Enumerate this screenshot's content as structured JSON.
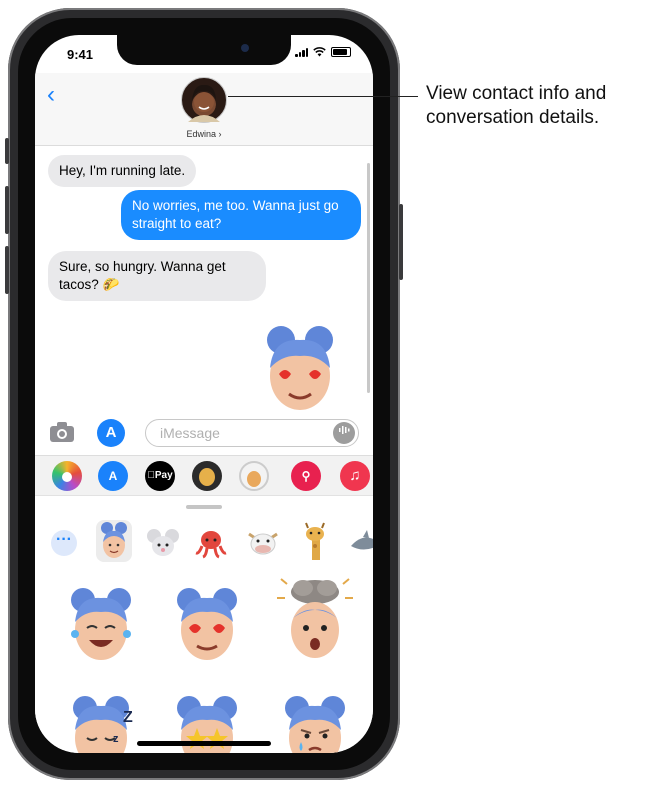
{
  "status_bar": {
    "time": "9:41"
  },
  "header": {
    "back_label": "‹",
    "contact_name": "Edwina ›"
  },
  "messages": [
    {
      "dir": "in",
      "text": "Hey, I'm running late."
    },
    {
      "dir": "out",
      "text": "No worries, me too. Wanna just go straight to eat?"
    },
    {
      "dir": "in",
      "text": "Sure, so hungry. Wanna get tacos? 🌮"
    }
  ],
  "compose": {
    "placeholder": "iMessage"
  },
  "app_drawer": {
    "apps": [
      "photos-icon",
      "app-store-icon",
      "apple-pay-icon",
      "memoji-icon",
      "memoji-stickers-icon",
      "search-images-icon",
      "music-icon"
    ],
    "apple_pay_label": "Pay"
  },
  "sticker_categories": [
    "more-icon",
    "memoji",
    "mouse",
    "octopus",
    "cow",
    "giraffe",
    "shark"
  ],
  "stickers": [
    "memoji-laughing-tears",
    "memoji-heart-eyes",
    "memoji-mind-blown",
    "memoji-sleeping",
    "memoji-star-struck",
    "memoji-crying"
  ],
  "callout": {
    "text": "View contact info and\nconversation details."
  },
  "colors": {
    "accent": "#1a82fb",
    "outgoing_bubble": "#1a8cff",
    "incoming_bubble": "#e9e9eb"
  }
}
